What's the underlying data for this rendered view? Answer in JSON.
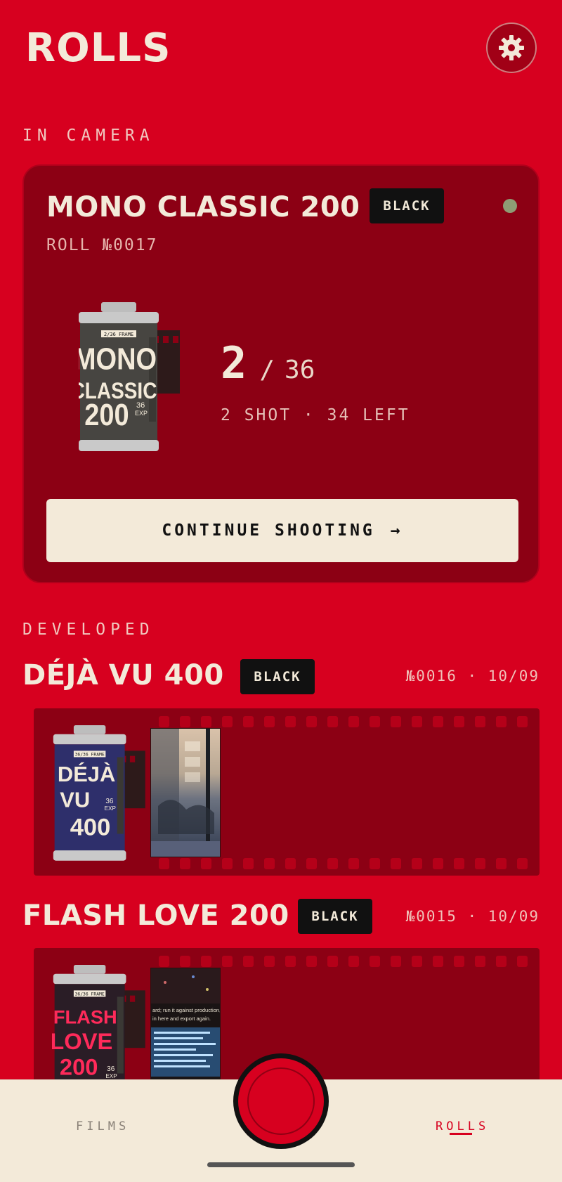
{
  "header": {
    "title": "ROLLS",
    "settings_icon": "gear-icon"
  },
  "in_camera": {
    "section_label": "IN CAMERA",
    "film_name": "MONO CLASSIC 200",
    "badge": "BLACK",
    "status_color": "#8e9c74",
    "roll_number": "ROLL №0017",
    "canister": {
      "frame_label": "2/36 FRAME",
      "lines": [
        "MONO",
        "CLASSIC",
        "200"
      ],
      "exp_count": "36",
      "exp_unit": "EXP"
    },
    "shots_taken": "2",
    "separator": "/",
    "shots_total": "36",
    "summary": "2 SHOT · 34 LEFT",
    "continue_label": "CONTINUE SHOOTING",
    "continue_arrow": "→"
  },
  "developed": {
    "section_label": "DEVELOPED",
    "rolls": [
      {
        "name": "DÉJÀ VU 400",
        "badge": "BLACK",
        "meta": "№0016 · 10/09",
        "canister": {
          "frame_label": "36/36 FRAME",
          "lines": [
            "DÉJÀ",
            "VU",
            "400"
          ],
          "exp_count": "36",
          "exp_unit": "EXP"
        }
      },
      {
        "name": "FLASH LOVE 200",
        "badge": "BLACK",
        "meta": "№0015 · 10/09",
        "canister": {
          "frame_label": "36/36 FRAME",
          "lines": [
            "FLASH",
            "LOVE",
            "200"
          ],
          "exp_count": "36",
          "exp_unit": "EXP"
        },
        "thumb_text": [
          "ard; run it against production,",
          "in here and export again."
        ]
      }
    ]
  },
  "nav": {
    "films_label": "FILMS",
    "rolls_label": "ROLLS",
    "active": "ROLLS"
  },
  "colors": {
    "background": "#d7001f",
    "card": "#8c0014",
    "cream": "#f3ead9",
    "badge": "#111111"
  }
}
